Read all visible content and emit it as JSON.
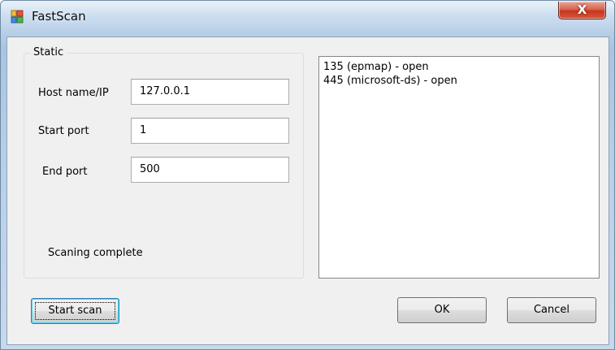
{
  "window": {
    "title": "FastScan",
    "close_glyph": "X",
    "icon": "fastscan-app-icon"
  },
  "static_group": {
    "legend": "Static",
    "host_label": "Host name/IP",
    "host_value": "127.0.0.1",
    "start_label": "Start port",
    "start_value": "1",
    "end_label": "End port",
    "end_value": "500",
    "status": "Scaning complete"
  },
  "results": [
    "135 (epmap) - open",
    "445 (microsoft-ds) - open"
  ],
  "buttons": {
    "start_scan": "Start scan",
    "ok": "OK",
    "cancel": "Cancel"
  }
}
